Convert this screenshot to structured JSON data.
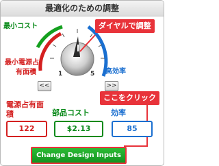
{
  "title": "最適化のための調整",
  "dial": {
    "label_min_cost": "最小コスト",
    "label_min_area_l1": "最小電源占",
    "label_min_area_l2": "有面積",
    "label_efficiency": "高効率",
    "tick_min": "1",
    "tick_max": "5",
    "prev_label": "<<",
    "next_label": ">>"
  },
  "callouts": {
    "dial_hint": "ダイヤルで調整",
    "click_hint": "ここをクリック"
  },
  "metrics": {
    "area_label_l1": "電源占有面",
    "area_label_l2": "積",
    "area_value": "122",
    "cost_label": "部品コスト",
    "cost_value": "$2.13",
    "eff_label": "効率",
    "eff_value": "85"
  },
  "button": {
    "label": "Change Design Inputs"
  },
  "colors": {
    "green": "#0a8a1a",
    "red": "#d42020",
    "blue": "#1a6fd0",
    "callout": "#e8333a"
  }
}
